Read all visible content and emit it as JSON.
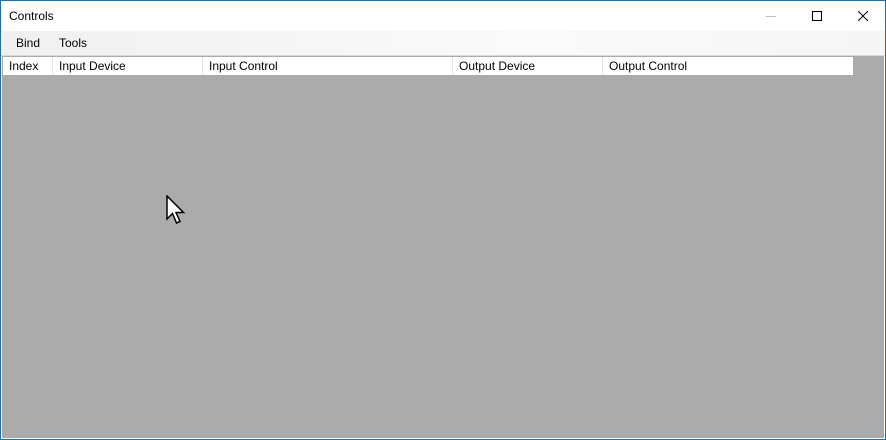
{
  "window": {
    "title": "Controls",
    "border_color": "#1f6fb5"
  },
  "titlebar_buttons": {
    "minimize": "minimize-icon",
    "maximize": "maximize-icon",
    "close": "close-icon"
  },
  "menubar": {
    "items": [
      {
        "label": "Bind"
      },
      {
        "label": "Tools"
      }
    ]
  },
  "table": {
    "columns": [
      {
        "label": "Index"
      },
      {
        "label": "Input Device"
      },
      {
        "label": "Input Control"
      },
      {
        "label": "Output Device"
      },
      {
        "label": "Output Control"
      }
    ],
    "rows": [],
    "background_color": "#ababab"
  },
  "cursor": {
    "icon": "mouse-pointer-icon"
  }
}
